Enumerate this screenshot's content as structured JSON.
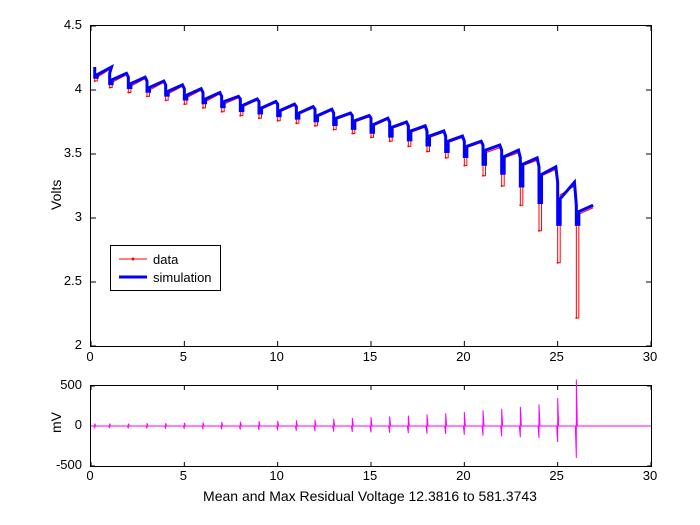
{
  "chart_data": [
    {
      "type": "line",
      "title": "",
      "xlabel": "",
      "ylabel": "Volts",
      "xlim": [
        0,
        30
      ],
      "ylim": [
        2,
        4.5
      ],
      "xticks": [
        0,
        5,
        10,
        15,
        20,
        25,
        30
      ],
      "yticks": [
        2,
        2.5,
        3,
        3.5,
        4,
        4.5
      ],
      "legend": {
        "position": "southwest-ish",
        "entries": [
          "data",
          "simulation"
        ]
      },
      "series": [
        {
          "name": "data",
          "color": "#ff0000",
          "marker": "dot",
          "pulses": [
            {
              "x": 0.2,
              "rest": 4.17,
              "dip": 4.07,
              "settle": 4.1
            },
            {
              "x": 1.0,
              "rest": 4.12,
              "dip": 4.02,
              "settle": 4.06
            },
            {
              "x": 2.0,
              "rest": 4.09,
              "dip": 3.98,
              "settle": 4.03
            },
            {
              "x": 3.0,
              "rest": 4.06,
              "dip": 3.95,
              "settle": 4.0
            },
            {
              "x": 4.0,
              "rest": 4.03,
              "dip": 3.92,
              "settle": 3.97
            },
            {
              "x": 5.0,
              "rest": 4.0,
              "dip": 3.89,
              "settle": 3.94
            },
            {
              "x": 6.0,
              "rest": 3.97,
              "dip": 3.86,
              "settle": 3.91
            },
            {
              "x": 7.0,
              "rest": 3.94,
              "dip": 3.83,
              "settle": 3.89
            },
            {
              "x": 8.0,
              "rest": 3.92,
              "dip": 3.8,
              "settle": 3.87
            },
            {
              "x": 9.0,
              "rest": 3.9,
              "dip": 3.78,
              "settle": 3.85
            },
            {
              "x": 10.0,
              "rest": 3.88,
              "dip": 3.76,
              "settle": 3.83
            },
            {
              "x": 11.0,
              "rest": 3.86,
              "dip": 3.74,
              "settle": 3.81
            },
            {
              "x": 12.0,
              "rest": 3.84,
              "dip": 3.72,
              "settle": 3.79
            },
            {
              "x": 13.0,
              "rest": 3.81,
              "dip": 3.69,
              "settle": 3.77
            },
            {
              "x": 14.0,
              "rest": 3.79,
              "dip": 3.66,
              "settle": 3.75
            },
            {
              "x": 15.0,
              "rest": 3.77,
              "dip": 3.63,
              "settle": 3.72
            },
            {
              "x": 16.0,
              "rest": 3.74,
              "dip": 3.6,
              "settle": 3.7
            },
            {
              "x": 17.0,
              "rest": 3.71,
              "dip": 3.56,
              "settle": 3.67
            },
            {
              "x": 18.0,
              "rest": 3.67,
              "dip": 3.52,
              "settle": 3.63
            },
            {
              "x": 19.0,
              "rest": 3.63,
              "dip": 3.47,
              "settle": 3.59
            },
            {
              "x": 20.0,
              "rest": 3.59,
              "dip": 3.41,
              "settle": 3.55
            },
            {
              "x": 21.0,
              "rest": 3.55,
              "dip": 3.33,
              "settle": 3.51
            },
            {
              "x": 22.0,
              "rest": 3.51,
              "dip": 3.25,
              "settle": 3.47
            },
            {
              "x": 23.0,
              "rest": 3.45,
              "dip": 3.1,
              "settle": 3.41
            },
            {
              "x": 24.0,
              "rest": 3.38,
              "dip": 2.9,
              "settle": 3.33
            },
            {
              "x": 25.0,
              "rest": 3.25,
              "dip": 2.65,
              "settle": 3.18
            },
            {
              "x": 26.0,
              "rest": 3.08,
              "dip": 2.22,
              "settle": 3.03
            }
          ]
        },
        {
          "name": "simulation",
          "color": "#0000ff",
          "pulses": [
            {
              "x": 0.2,
              "rest": 4.18,
              "dip": 4.1,
              "settle": 4.12
            },
            {
              "x": 1.0,
              "rest": 4.13,
              "dip": 4.05,
              "settle": 4.08
            },
            {
              "x": 2.0,
              "rest": 4.1,
              "dip": 4.02,
              "settle": 4.05
            },
            {
              "x": 3.0,
              "rest": 4.07,
              "dip": 3.99,
              "settle": 4.02
            },
            {
              "x": 4.0,
              "rest": 4.04,
              "dip": 3.96,
              "settle": 3.99
            },
            {
              "x": 5.0,
              "rest": 4.01,
              "dip": 3.93,
              "settle": 3.96
            },
            {
              "x": 6.0,
              "rest": 3.98,
              "dip": 3.9,
              "settle": 3.93
            },
            {
              "x": 7.0,
              "rest": 3.95,
              "dip": 3.87,
              "settle": 3.91
            },
            {
              "x": 8.0,
              "rest": 3.93,
              "dip": 3.84,
              "settle": 3.88
            },
            {
              "x": 9.0,
              "rest": 3.91,
              "dip": 3.82,
              "settle": 3.86
            },
            {
              "x": 10.0,
              "rest": 3.89,
              "dip": 3.8,
              "settle": 3.84
            },
            {
              "x": 11.0,
              "rest": 3.87,
              "dip": 3.78,
              "settle": 3.82
            },
            {
              "x": 12.0,
              "rest": 3.85,
              "dip": 3.76,
              "settle": 3.8
            },
            {
              "x": 13.0,
              "rest": 3.82,
              "dip": 3.73,
              "settle": 3.78
            },
            {
              "x": 14.0,
              "rest": 3.8,
              "dip": 3.7,
              "settle": 3.76
            },
            {
              "x": 15.0,
              "rest": 3.78,
              "dip": 3.67,
              "settle": 3.73
            },
            {
              "x": 16.0,
              "rest": 3.75,
              "dip": 3.64,
              "settle": 3.71
            },
            {
              "x": 17.0,
              "rest": 3.72,
              "dip": 3.61,
              "settle": 3.68
            },
            {
              "x": 18.0,
              "rest": 3.68,
              "dip": 3.57,
              "settle": 3.64
            },
            {
              "x": 19.0,
              "rest": 3.64,
              "dip": 3.52,
              "settle": 3.6
            },
            {
              "x": 20.0,
              "rest": 3.6,
              "dip": 3.48,
              "settle": 3.56
            },
            {
              "x": 21.0,
              "rest": 3.57,
              "dip": 3.42,
              "settle": 3.53
            },
            {
              "x": 22.0,
              "rest": 3.53,
              "dip": 3.35,
              "settle": 3.48
            },
            {
              "x": 23.0,
              "rest": 3.47,
              "dip": 3.25,
              "settle": 3.42
            },
            {
              "x": 24.0,
              "rest": 3.4,
              "dip": 3.12,
              "settle": 3.34
            },
            {
              "x": 25.0,
              "rest": 3.28,
              "dip": 2.95,
              "settle": 3.15
            },
            {
              "x": 26.0,
              "rest": 3.1,
              "dip": 2.95,
              "settle": 3.05
            }
          ]
        }
      ]
    },
    {
      "type": "line",
      "title": "",
      "xlabel": "Mean and Max Residual Voltage 12.3816 to 581.3743",
      "ylabel": "mV",
      "xlim": [
        0,
        30
      ],
      "ylim": [
        -500,
        500
      ],
      "xticks": [
        0,
        5,
        10,
        15,
        20,
        25,
        30
      ],
      "yticks": [
        -500,
        0,
        500
      ],
      "residual_mean": 12.3816,
      "residual_max": 581.3743,
      "series": [
        {
          "name": "residual",
          "color": "#ff00ff",
          "baseline": 0,
          "spikes": [
            {
              "x": 0.2,
              "vpos": 30,
              "vneg": -20
            },
            {
              "x": 1.0,
              "vpos": 30,
              "vneg": -25
            },
            {
              "x": 2.0,
              "vpos": 30,
              "vneg": -30
            },
            {
              "x": 3.0,
              "vpos": 35,
              "vneg": -30
            },
            {
              "x": 4.0,
              "vpos": 35,
              "vneg": -35
            },
            {
              "x": 5.0,
              "vpos": 40,
              "vneg": -35
            },
            {
              "x": 6.0,
              "vpos": 45,
              "vneg": -40
            },
            {
              "x": 7.0,
              "vpos": 50,
              "vneg": -40
            },
            {
              "x": 8.0,
              "vpos": 55,
              "vneg": -45
            },
            {
              "x": 9.0,
              "vpos": 60,
              "vneg": -50
            },
            {
              "x": 10.0,
              "vpos": 65,
              "vneg": -55
            },
            {
              "x": 11.0,
              "vpos": 70,
              "vneg": -60
            },
            {
              "x": 12.0,
              "vpos": 80,
              "vneg": -65
            },
            {
              "x": 13.0,
              "vpos": 90,
              "vneg": -70
            },
            {
              "x": 14.0,
              "vpos": 100,
              "vneg": -75
            },
            {
              "x": 15.0,
              "vpos": 110,
              "vneg": -80
            },
            {
              "x": 16.0,
              "vpos": 120,
              "vneg": -85
            },
            {
              "x": 17.0,
              "vpos": 130,
              "vneg": -90
            },
            {
              "x": 18.0,
              "vpos": 145,
              "vneg": -95
            },
            {
              "x": 19.0,
              "vpos": 160,
              "vneg": -100
            },
            {
              "x": 20.0,
              "vpos": 175,
              "vneg": -110
            },
            {
              "x": 21.0,
              "vpos": 195,
              "vneg": -120
            },
            {
              "x": 22.0,
              "vpos": 215,
              "vneg": -130
            },
            {
              "x": 23.0,
              "vpos": 240,
              "vneg": -140
            },
            {
              "x": 24.0,
              "vpos": 270,
              "vneg": -150
            },
            {
              "x": 25.0,
              "vpos": 350,
              "vneg": -200
            },
            {
              "x": 26.0,
              "vpos": 581,
              "vneg": -400
            }
          ]
        }
      ]
    }
  ]
}
